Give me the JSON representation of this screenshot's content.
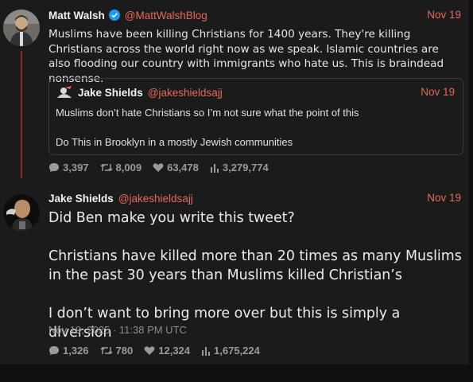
{
  "tweet1": {
    "name": "Matt Walsh",
    "handle": "@MattWalshBlog",
    "date": "Nov 19",
    "text": "Muslims have been killing Christians for 1400 years. They're killing Christians across the world right now as we speak. Islamic countries are also flooding our country with immigrants who hate us. This is braindead nonsense.",
    "quote": {
      "name": "Jake Shields",
      "handle": "@jakeshieldsajj",
      "date": "Nov 19",
      "line1": "Muslims don’t hate Christians so I’m not sure what the point of this",
      "line2": "Do This in Brooklyn in a mostly Jewish  communities"
    },
    "stats": {
      "replies": "3,397",
      "retweets": "8,009",
      "likes": "63,478",
      "views": "3,279,774"
    }
  },
  "tweet2": {
    "name": "Jake Shields",
    "handle": "@jakeshieldsajj",
    "date": "Nov 19",
    "p1": "Did Ben make you write this tweet?",
    "p2": "Christians have killed more than 20 times as many Muslims in the past 30 years than Muslims killed Christian’s",
    "p3": "I don’t want to bring more over but this is simply a diversion",
    "timestamp": "Nov 19, 2025 · 11:38 PM UTC",
    "stats": {
      "replies": "1,326",
      "retweets": "780",
      "likes": "12,324",
      "views": "1,675,224"
    }
  },
  "colors": {
    "accent": "#e6685a",
    "verified": "#1d9bf0",
    "thread_line": "#8a2a2a",
    "background": "#1b1b1c"
  }
}
